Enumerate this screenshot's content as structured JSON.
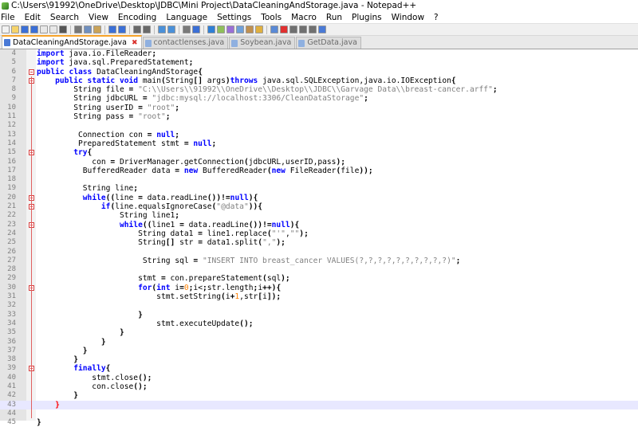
{
  "window": {
    "title": "C:\\Users\\91992\\OneDrive\\Desktop\\JDBC\\Mini Project\\DataCleaningAndStorage.java - Notepad++"
  },
  "menu": [
    "File",
    "Edit",
    "Search",
    "View",
    "Encoding",
    "Language",
    "Settings",
    "Tools",
    "Macro",
    "Run",
    "Plugins",
    "Window",
    "?"
  ],
  "tabs": [
    {
      "label": "DataCleaningAndStorage.java",
      "active": true
    },
    {
      "label": "contactlenses.java",
      "active": false
    },
    {
      "label": "Soybean.java",
      "active": false
    },
    {
      "label": "GetData.java",
      "active": false
    }
  ],
  "toolbar_icons": [
    "new-file-icon",
    "open-file-icon",
    "save-icon",
    "save-all-icon",
    "close-icon",
    "close-all-icon",
    "print-icon",
    "cut-icon",
    "copy-icon",
    "paste-icon",
    "undo-icon",
    "redo-icon",
    "find-icon",
    "replace-icon",
    "zoom-in-icon",
    "zoom-out-icon",
    "sync-scroll-icon",
    "word-wrap-icon",
    "show-all-chars-icon",
    "indent-guide-icon",
    "lang-icon",
    "doc-map-icon",
    "function-list-icon",
    "folder-workspace-icon",
    "monitor-icon",
    "record-macro-icon",
    "stop-record-icon",
    "play-macro-icon",
    "play-multiple-icon",
    "save-macro-icon"
  ],
  "colors": {
    "tab_accent": "#f7a32a",
    "keyword": "#0000ff",
    "type": "#8000ff",
    "string": "#808080",
    "number": "#ff8000",
    "fold_marker": "#d94040"
  },
  "code": [
    {
      "n": "4",
      "code": "import java.io.FileReader;"
    },
    {
      "n": "5",
      "code": "import java.sql.PreparedStatement;"
    },
    {
      "n": "6",
      "code": "public class DataCleaningAndStorage{"
    },
    {
      "n": "7",
      "code": "    public static void main(String[] args)throws java.sql.SQLException,java.io.IOException{"
    },
    {
      "n": "8",
      "code": "        String file = \"C:\\\\Users\\\\91992\\\\OneDrive\\\\Desktop\\\\JDBC\\\\Garvage Data\\\\breast-cancer.arff\";"
    },
    {
      "n": "9",
      "code": "        String jdbcURL = \"jdbc:mysql://localhost:3306/CleanDataStorage\";"
    },
    {
      "n": "10",
      "code": "        String userID = \"root\";"
    },
    {
      "n": "11",
      "code": "        String pass = \"root\";"
    },
    {
      "n": "12",
      "code": ""
    },
    {
      "n": "13",
      "code": "         Connection con = null;"
    },
    {
      "n": "14",
      "code": "         PreparedStatement stmt = null;"
    },
    {
      "n": "15",
      "code": "        try{"
    },
    {
      "n": "16",
      "code": "            con = DriverManager.getConnection(jdbcURL,userID,pass);"
    },
    {
      "n": "17",
      "code": "          BufferedReader data = new BufferedReader(new FileReader(file));"
    },
    {
      "n": "18",
      "code": ""
    },
    {
      "n": "19",
      "code": "          String line;"
    },
    {
      "n": "20",
      "code": "          while((line = data.readLine())!=null){"
    },
    {
      "n": "21",
      "code": "              if(line.equalsIgnoreCase(\"@data\")){"
    },
    {
      "n": "22",
      "code": "                  String line1;"
    },
    {
      "n": "23",
      "code": "                  while((line1 = data.readLine())!=null){"
    },
    {
      "n": "24",
      "code": "                      String data1 = line1.replace(\"'\",\"\");"
    },
    {
      "n": "25",
      "code": "                      String[] str = data1.split(\",\");"
    },
    {
      "n": "26",
      "code": ""
    },
    {
      "n": "27",
      "code": "                       String sql = \"INSERT INTO breast_cancer VALUES(?,?,?,?,?,?,?,?,?,?)\";"
    },
    {
      "n": "28",
      "code": ""
    },
    {
      "n": "29",
      "code": "                      stmt = con.prepareStatement(sql);"
    },
    {
      "n": "30",
      "code": "                      for(int i=0;i<str.length;i++){"
    },
    {
      "n": "31",
      "code": "                          stmt.setString(i+1,str[i]);"
    },
    {
      "n": "32",
      "code": ""
    },
    {
      "n": "33",
      "code": "                      }"
    },
    {
      "n": "34",
      "code": "                          stmt.executeUpdate();"
    },
    {
      "n": "35",
      "code": "                  }"
    },
    {
      "n": "36",
      "code": "              }"
    },
    {
      "n": "37",
      "code": "          }"
    },
    {
      "n": "38",
      "code": "        }"
    },
    {
      "n": "39",
      "code": "        finally{"
    },
    {
      "n": "40",
      "code": "            stmt.close();"
    },
    {
      "n": "41",
      "code": "            con.close();"
    },
    {
      "n": "42",
      "code": "        }"
    },
    {
      "n": "43",
      "code": "    }"
    },
    {
      "n": "44",
      "code": ""
    },
    {
      "n": "45",
      "code": "}"
    }
  ]
}
